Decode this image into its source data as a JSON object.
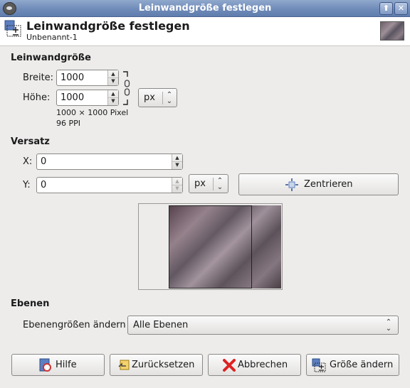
{
  "window": {
    "title": "Leinwandgröße festlegen",
    "maximize_glyph": "⬆",
    "close_glyph": "✕"
  },
  "header": {
    "title": "Leinwandgröße festlegen",
    "subtitle": "Unbenannt-1"
  },
  "canvas_size": {
    "section": "Leinwandgröße",
    "width_label": "Breite:",
    "width_value": "1000",
    "height_label": "Höhe:",
    "height_value": "1000",
    "unit": "px",
    "size_info": "1000 × 1000 Pixel",
    "resolution_info": "96 PPI"
  },
  "offset": {
    "section": "Versatz",
    "x_label": "X:",
    "x_value": "0",
    "y_label": "Y:",
    "y_value": "0",
    "unit": "px",
    "center_button": "Zentrieren"
  },
  "layers": {
    "section": "Ebenen",
    "resize_label": "Ebenengrößen ändern",
    "resize_value": "Alle Ebenen"
  },
  "buttons": {
    "help": "Hilfe",
    "reset": "Zurücksetzen",
    "cancel": "Abbrechen",
    "resize": "Größe ändern"
  }
}
